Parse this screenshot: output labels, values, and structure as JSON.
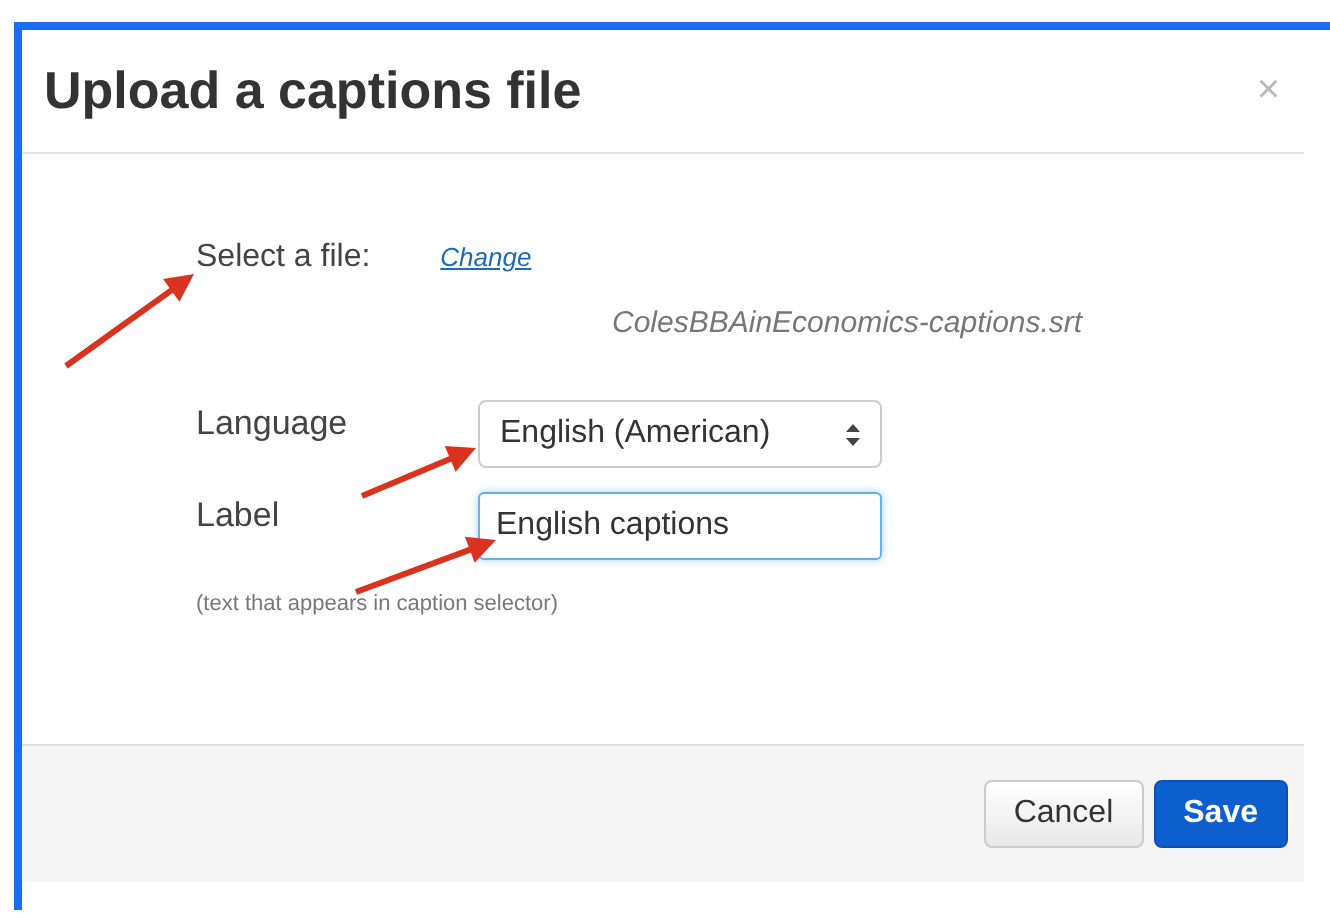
{
  "dialog": {
    "title": "Upload a captions file",
    "close": "×"
  },
  "file": {
    "label": "Select a file:",
    "link": "Change",
    "filename": "ColesBBAinEconomics-captions.srt"
  },
  "language": {
    "label": "Language",
    "value": "English (American)"
  },
  "caption_label": {
    "label": "Label",
    "value": "English captions",
    "focused": true,
    "hint": "(text that appears in caption selector)"
  },
  "buttons": [
    {
      "label": "Cancel",
      "kind": "default"
    },
    {
      "label": "Save",
      "kind": "primary"
    }
  ]
}
